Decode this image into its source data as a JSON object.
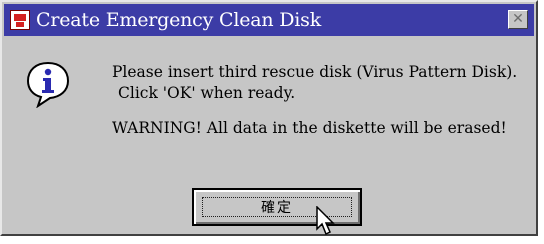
{
  "window": {
    "title": "Create Emergency Clean Disk",
    "close_symbol": "✕"
  },
  "message": {
    "line1": "Please insert third rescue disk (Virus Pattern Disk).",
    "line2": "Click 'OK' when ready.",
    "warning": "WARNING! All data in the diskette will be erased!"
  },
  "buttons": {
    "ok_label": "確定"
  },
  "icons": {
    "app": "emergency-disk-icon",
    "info": "information-icon",
    "cursor": "mouse-pointer-icon"
  },
  "colors": {
    "titlebar": "#3c3ca6",
    "window_bg": "#c6c6c6",
    "info_blue": "#2a2ab0"
  }
}
